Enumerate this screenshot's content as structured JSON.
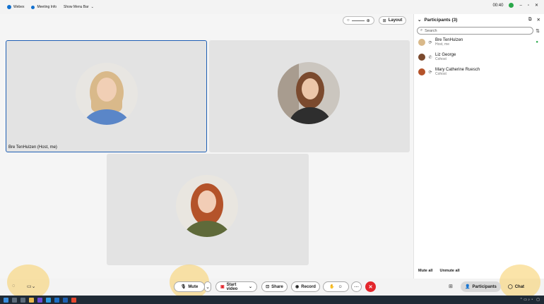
{
  "titlebar": {
    "app": "Webex",
    "meeting_info": "Meeting Info",
    "show_menu_bar": "Show Menu Bar",
    "timer": "00:40"
  },
  "stage": {
    "layout_label": "Layout",
    "tiles": [
      {
        "name": "Bre TenHulzen (Host, me)",
        "hair": "#d9b98a",
        "shirt": "#5a86c8"
      },
      {
        "name": "",
        "hair": "#7b4a2e",
        "shirt": "#2e2e2e"
      },
      {
        "name": "",
        "hair": "#b4532a",
        "shirt": "#5f6a3a"
      }
    ]
  },
  "participants": {
    "title": "Participants (3)",
    "search_placeholder": "Search",
    "list": [
      {
        "name": "Bre TenHulzen",
        "role": "Host, me"
      },
      {
        "name": "Liz George",
        "role": "Cohost"
      },
      {
        "name": "Mary Catherine Ruesch",
        "role": "Cohost"
      }
    ],
    "mute_all": "Mute all",
    "unmute_all": "Unmute all"
  },
  "controls": {
    "mute": "Mute",
    "start_video": "Start video",
    "share": "Share",
    "record": "Record",
    "participants": "Participants",
    "chat": "Chat"
  },
  "colors": {
    "accent": "#1170cf",
    "end_call": "#e3262c",
    "active_tile_border": "#1f5fb4",
    "halo": "#f7cd63"
  },
  "icons": [
    "webex-logo-icon",
    "info-icon",
    "chevron-down-icon",
    "recording-icon",
    "minimize-icon",
    "maximize-icon",
    "close-icon",
    "zoom-icon",
    "layout-icon",
    "popout-icon",
    "search-icon",
    "sort-icon",
    "microphone-icon",
    "camera-icon",
    "share-icon",
    "record-icon",
    "reactions-icon",
    "more-icon",
    "end-call-icon",
    "participants-icon",
    "chat-icon"
  ]
}
